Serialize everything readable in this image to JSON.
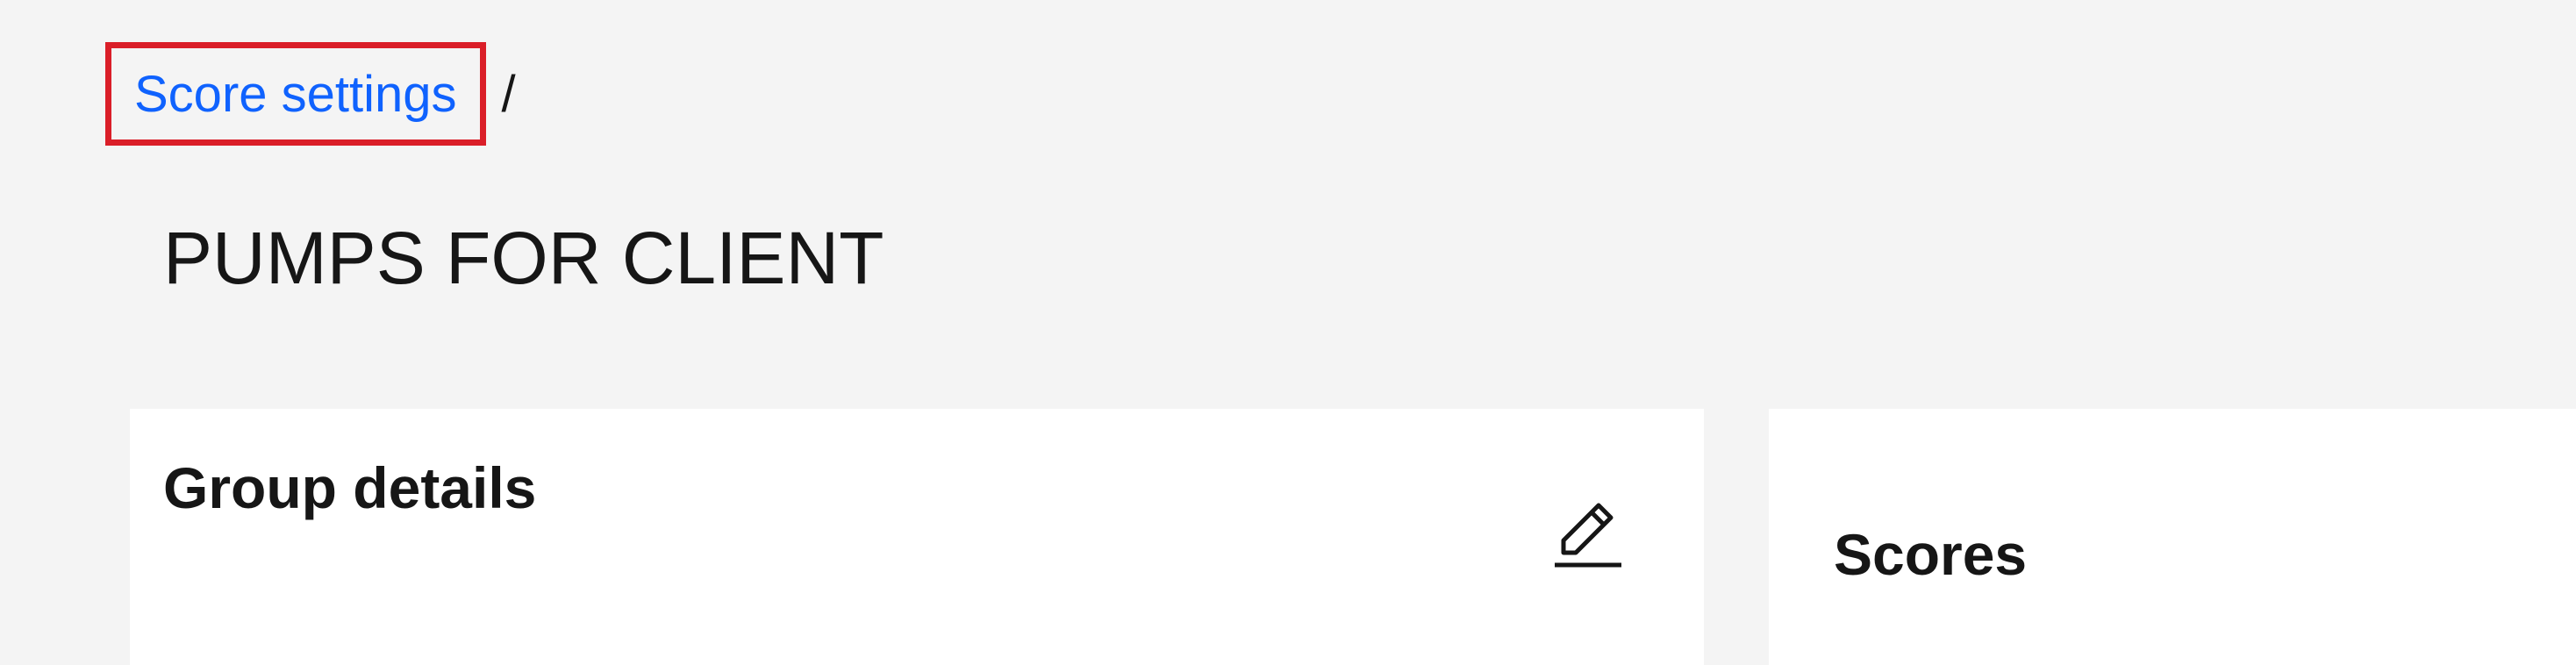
{
  "breadcrumb": {
    "items": [
      {
        "label": "Score settings"
      }
    ],
    "separator": "/"
  },
  "page": {
    "title": "PUMPS FOR CLIENT"
  },
  "group_details": {
    "title": "Group details",
    "edit_icon": "edit-pencil-icon"
  },
  "scores": {
    "title": "Scores"
  },
  "colors": {
    "background": "#f4f4f4",
    "card": "#ffffff",
    "link": "#0f62fe",
    "highlight_border": "#da1e28",
    "text": "#161616"
  }
}
